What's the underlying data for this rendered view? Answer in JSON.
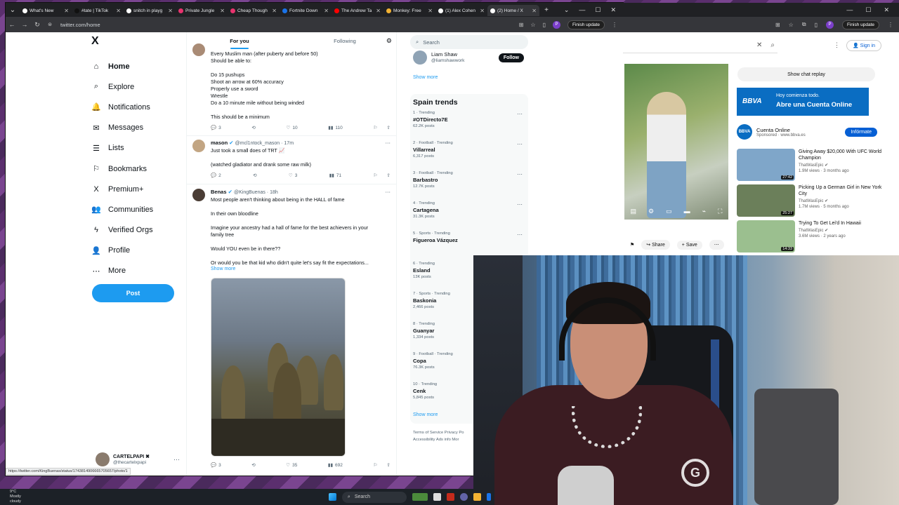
{
  "browser": {
    "tabs": [
      {
        "label": "What's New",
        "color": "#ffffff"
      },
      {
        "label": "#tate | TikTok",
        "color": "#111111"
      },
      {
        "label": "snitch in playg",
        "color": "#ffffff"
      },
      {
        "label": "Private Jungle",
        "color": "#e8336e"
      },
      {
        "label": "Cheap Though",
        "color": "#e8336e"
      },
      {
        "label": "Fortnite Down",
        "color": "#1a73e8"
      },
      {
        "label": "The Andrew Ta",
        "color": "#ff0000"
      },
      {
        "label": "Monkey: Free",
        "color": "#f2b233"
      },
      {
        "label": "(1) Alex Cohen",
        "color": "#ffffff"
      },
      {
        "label": "(2) Home / X",
        "color": "#ffffff"
      }
    ],
    "url": "twitter.com/home",
    "profile_letter": "P",
    "finish_update": "Finish update",
    "status_url": "https://twitter.com/KingBuenas/status/1743814906665705657/photo/1"
  },
  "x": {
    "logo": "X",
    "nav": [
      {
        "label": "Home",
        "icon": "⌂"
      },
      {
        "label": "Explore",
        "icon": "⌕"
      },
      {
        "label": "Notifications",
        "icon": "🔔"
      },
      {
        "label": "Messages",
        "icon": "✉"
      },
      {
        "label": "Lists",
        "icon": "☰"
      },
      {
        "label": "Bookmarks",
        "icon": "⚐"
      },
      {
        "label": "Premium+",
        "icon": "X"
      },
      {
        "label": "Communities",
        "icon": "👥"
      },
      {
        "label": "Verified Orgs",
        "icon": "ϟ"
      },
      {
        "label": "Profile",
        "icon": "👤"
      },
      {
        "label": "More",
        "icon": "⋯"
      }
    ],
    "post_button": "Post",
    "account": {
      "name": "CARTELPAPI ✖",
      "handle": "@thecartelxpapi"
    },
    "feed_tabs": {
      "for_you": "For you",
      "following": "Following"
    },
    "tweets": [
      {
        "lines": [
          "Every Muslim man (after puberty and before 50)",
          "Should be able to:",
          "",
          "Do 15 pushups",
          "Shoot an arrow at 60% accuracy",
          "Properly use a sword",
          "Wrestle",
          "Do a 10 minute mile without being winded",
          "",
          "This should be a minimum"
        ],
        "replies": "3",
        "retweets": "",
        "likes": "10",
        "views": "110"
      },
      {
        "name": "mason",
        "handle": "@mcl1ntock_mason · 17m",
        "lines": [
          "Just took a small does of TRT 📈",
          "",
          "(watched gladiator and drank some raw milk)"
        ],
        "replies": "2",
        "retweets": "",
        "likes": "3",
        "views": "71"
      },
      {
        "name": "Benas",
        "handle": "@KingBuenas · 18h",
        "lines": [
          "Most people aren't thinking about being in the HALL of fame",
          "",
          "In their own bloodline",
          "",
          "Imagine your ancestry had a hall of fame for the best achievers in your",
          "family tree",
          "",
          "Would YOU even be in there??",
          "",
          "Or would you be that kid who didn't quite let's say fit the expectations..."
        ],
        "show_more": "Show more",
        "replies": "3",
        "retweets": "",
        "likes": "35",
        "views": "692"
      }
    ],
    "search_placeholder": "Search",
    "who_to_follow": {
      "name": "Liam Shaw",
      "handle": "@liamshawwork",
      "button": "Follow",
      "show_more": "Show more"
    },
    "trends_title": "Spain trends",
    "trends": [
      {
        "cat": "1 · Trending",
        "name": "#OTDirecto7E",
        "count": "62.2K posts"
      },
      {
        "cat": "2 · Football · Trending",
        "name": "Villarreal",
        "count": "6,317 posts"
      },
      {
        "cat": "3 · Football · Trending",
        "name": "Barbastro",
        "count": "12.7K posts"
      },
      {
        "cat": "4 · Trending",
        "name": "Cartagena",
        "count": "31.3K posts"
      },
      {
        "cat": "5 · Sports · Trending",
        "name": "Figueroa Vázquez",
        "count": ""
      },
      {
        "cat": "6 · Trending",
        "name": "Esland",
        "count": "13K posts"
      },
      {
        "cat": "7 · Sports · Trending",
        "name": "Baskonia",
        "count": "2,466 posts"
      },
      {
        "cat": "8 · Trending",
        "name": "Guanyar",
        "count": "1,334 posts"
      },
      {
        "cat": "9 · Football · Trending",
        "name": "Copa",
        "count": "76.3K posts"
      },
      {
        "cat": "10 · Trending",
        "name": "Cenk",
        "count": "5,845 posts"
      }
    ],
    "trends_show_more": "Show more",
    "footer": [
      "Terms of Service   Privacy Po",
      "Accessibility   Ads info   Mor"
    ]
  },
  "youtube": {
    "sign_in": "Sign in",
    "show_chat_replay": "Show chat replay",
    "share": "Share",
    "save": "Save",
    "ad": {
      "brand": "BBVA",
      "line1": "Hoy comienza todo.",
      "line2": "Abre una Cuenta Online",
      "title": "Cuenta Online",
      "sub": "Sponsored · www.bbva.es",
      "button": "Infórmate"
    },
    "recs": [
      {
        "title": "Giving Away $20,000 With UFC World Champion",
        "channel": "ThatWasEpic ✔",
        "stats": "1.9M views · 3 months ago",
        "duration": "27:42",
        "color": "#7fa6c9"
      },
      {
        "title": "Picking Up a German Girl in New York City",
        "channel": "ThatWasEpic ✔",
        "stats": "1.7M views · 5 months ago",
        "duration": "25:27",
        "color": "#6b7f5a"
      },
      {
        "title": "Trying To Get Lei'd In Hawaii",
        "channel": "ThatWasEpic ✔",
        "stats": "3.6M views · 2 years ago",
        "duration": "14:33",
        "color": "#9bbf8f"
      }
    ]
  },
  "taskbar": {
    "temp": "9°C",
    "weather": "Mostly cloudy",
    "search": "Search"
  }
}
